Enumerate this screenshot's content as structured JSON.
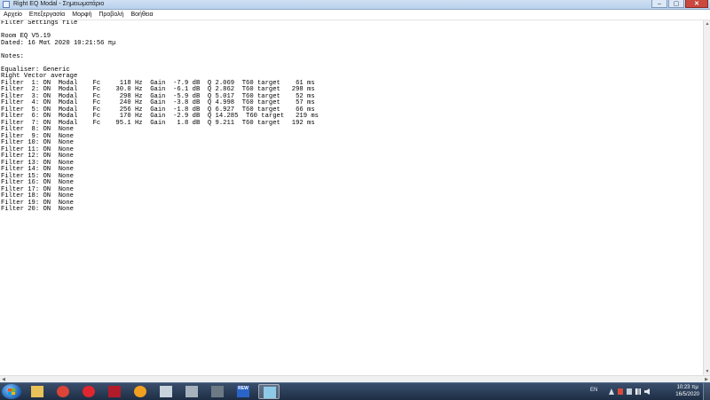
{
  "window": {
    "title": "Right EQ Modal - Σημειωματάριο",
    "controls": {
      "minimize": "–",
      "maximize": "▢",
      "close": "✕"
    }
  },
  "menu": {
    "items": [
      "Αρχείο",
      "Επεξεργασία",
      "Μορφή",
      "Προβολή",
      "Βοήθεια"
    ]
  },
  "document": {
    "lines": [
      "Filter Settings file",
      "",
      "Room EQ V5.19",
      "Dated: 16 Μαϊ 2020 10:21:56 πμ",
      "",
      "Notes:",
      "",
      "Equaliser: Generic",
      "Right Vector average",
      "Filter  1: ON  Modal    Fc     118 Hz  Gain  -7.9 dB  Q 2.069  T60 target    61 ms",
      "Filter  2: ON  Modal    Fc    30.0 Hz  Gain  -6.1 dB  Q 2.862  T60 target   298 ms",
      "Filter  3: ON  Modal    Fc     298 Hz  Gain  -5.9 dB  Q 5.017  T60 target    52 ms",
      "Filter  4: ON  Modal    Fc     240 Hz  Gain  -3.8 dB  Q 4.998  T60 target    57 ms",
      "Filter  5: ON  Modal    Fc     256 Hz  Gain  -1.8 dB  Q 6.927  T60 target    66 ms",
      "Filter  6: ON  Modal    Fc     170 Hz  Gain  -2.9 dB  Q 14.285  T60 target   219 ms",
      "Filter  7: ON  Modal    Fc    95.1 Hz  Gain   1.8 dB  Q 9.211  T60 target   192 ms",
      "Filter  8: ON  None",
      "Filter  9: ON  None",
      "Filter 10: ON  None",
      "Filter 11: ON  None",
      "Filter 12: ON  None",
      "Filter 13: ON  None",
      "Filter 14: ON  None",
      "Filter 15: ON  None",
      "Filter 16: ON  None",
      "Filter 17: ON  None",
      "Filter 18: ON  None",
      "Filter 19: ON  None",
      "Filter 20: ON  None"
    ]
  },
  "taskbar": {
    "apps": [
      {
        "name": "file-explorer-icon",
        "color": "#e8c35a"
      },
      {
        "name": "chrome-icon",
        "color": "#db4437"
      },
      {
        "name": "opera-icon",
        "color": "#e0262f"
      },
      {
        "name": "matrix-app-icon",
        "color": "#b11b2a"
      },
      {
        "name": "vpn-shield-icon",
        "color": "#f0a020"
      },
      {
        "name": "notepad-icon",
        "color": "#c9d3dc"
      },
      {
        "name": "settings-gears-icon",
        "color": "#a7b2bd"
      },
      {
        "name": "alien-app-icon",
        "color": "#6d7a86"
      },
      {
        "name": "rew-icon",
        "color": "#2a64c8",
        "label": "REW"
      },
      {
        "name": "notepad-active-icon",
        "color": "#8fc9e8"
      }
    ],
    "tray": {
      "language": "EN",
      "time": "10:23 πμ",
      "date": "16/5/2020"
    }
  }
}
